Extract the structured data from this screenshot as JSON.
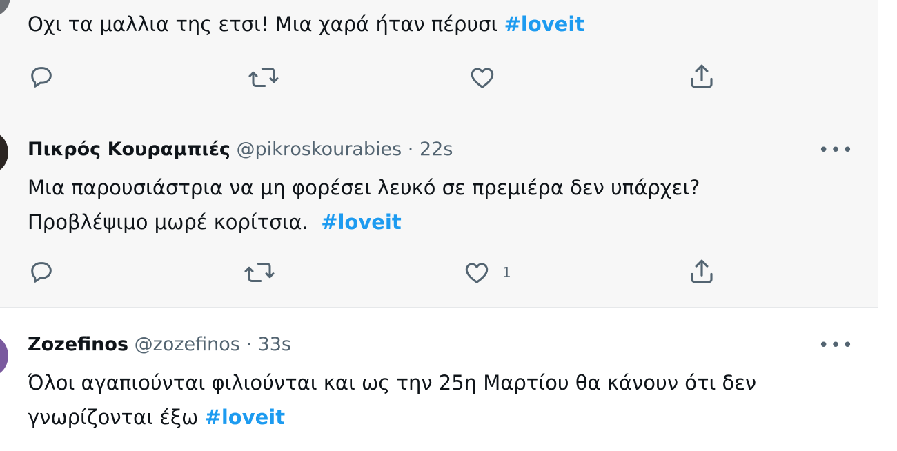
{
  "tweets": [
    {
      "text": "Οχι τα μαλλια της ετσι! Μια χαρά ήταν πέρυσι ",
      "hashtag": "#loveit"
    },
    {
      "name": "Πικρός Κουραμπιές",
      "handle": "@pikroskourabies",
      "separator": "·",
      "time": "22s",
      "line1": "Μια παρουσιάστρια να μη φορέσει λευκό σε πρεμιέρα δεν υπάρχει?",
      "line2": "Προβλέψιμο μωρέ κορίτσια.  ",
      "hashtag": "#loveit",
      "like_count": "1"
    },
    {
      "name": "Zozefinos",
      "handle": "@zozefinos",
      "separator": "·",
      "time": "33s",
      "line1": "Όλοι αγαπιούνται φιλιούνται και ως την 25η Μαρτίου θα κάνουν ότι δεν",
      "line2": "γνωρίζονται έξω ",
      "hashtag": "#loveit"
    }
  ],
  "more_label": "•••",
  "colors": {
    "hashtag": "#1d9bf0",
    "muted": "#536471",
    "text": "#0f1419"
  },
  "icons": [
    "reply-icon",
    "retweet-icon",
    "like-icon",
    "share-icon",
    "more-icon"
  ]
}
